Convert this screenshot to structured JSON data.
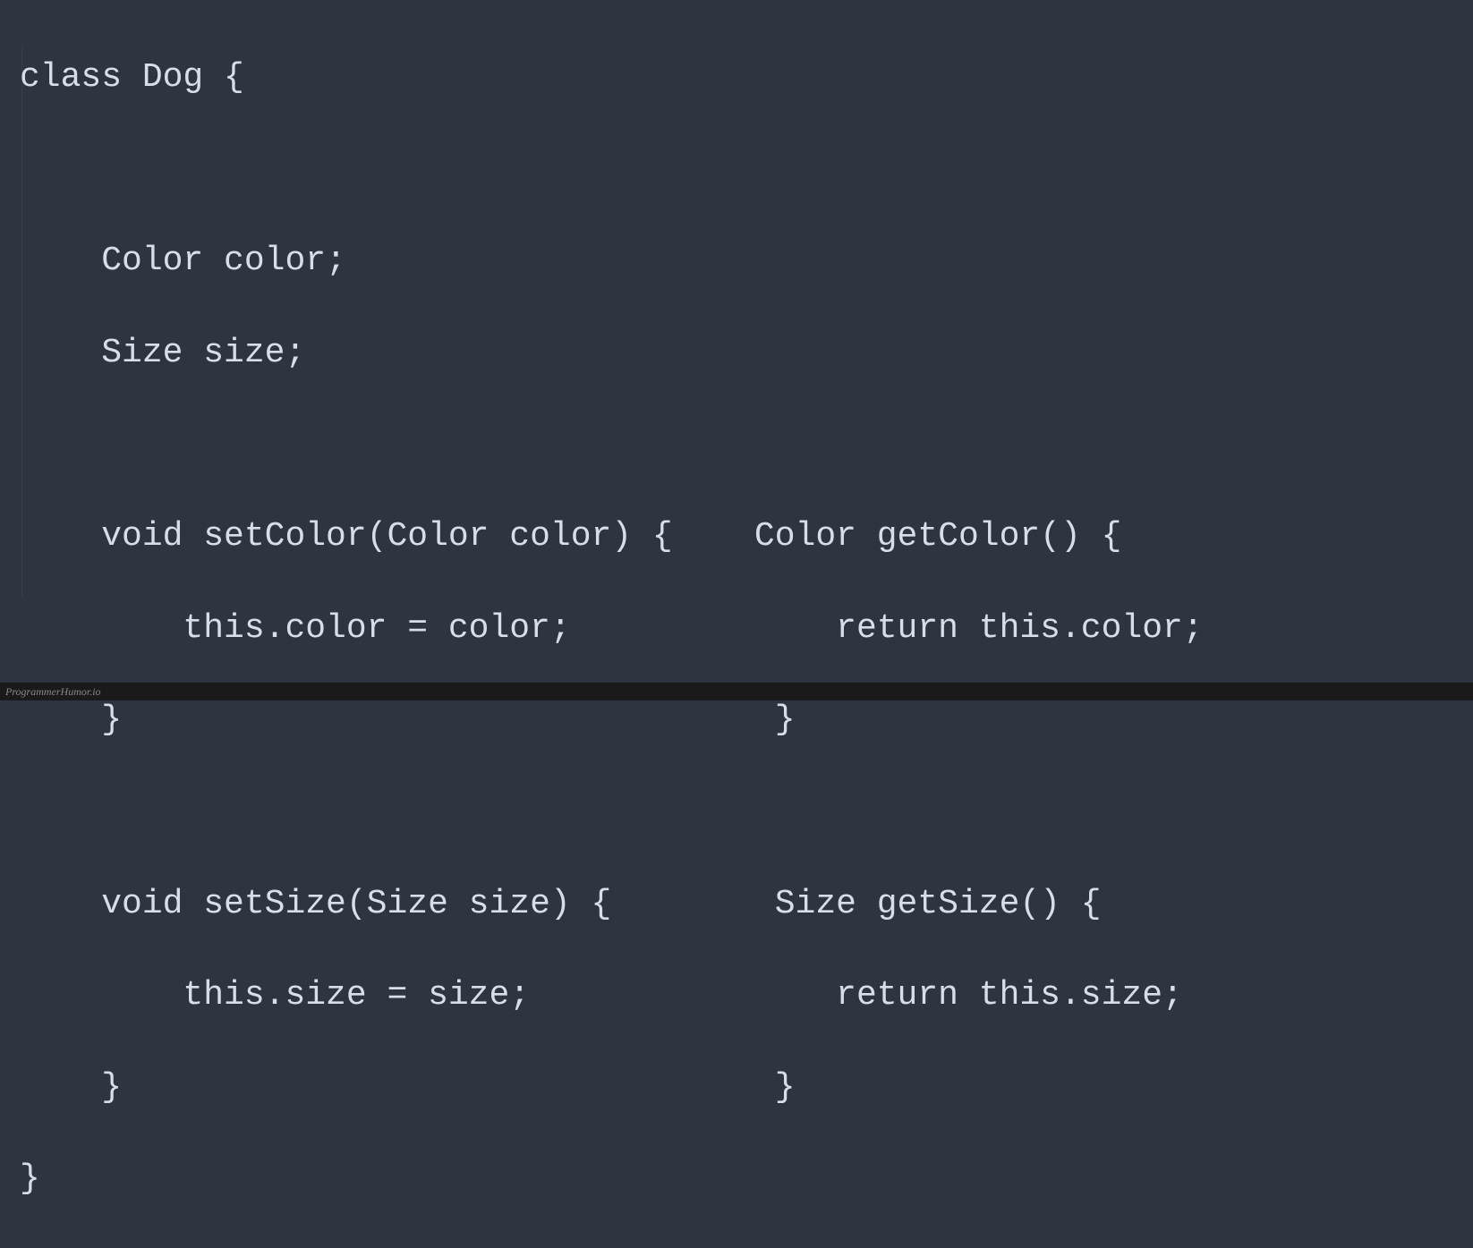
{
  "code": {
    "line1": "class Dog {",
    "line2": "",
    "line3": "    Color color;",
    "line4": "    Size size;",
    "line5": "",
    "line6": "    void setColor(Color color) {    Color getColor() {",
    "line7": "        this.color = color;             return this.color;",
    "line8": "    }                                }",
    "line9": "",
    "line10": "    void setSize(Size size) {        Size getSize() {",
    "line11": "        this.size = size;               return this.size;",
    "line12": "    }                                }",
    "line13": "}"
  },
  "watermark": "ProgrammerHumor.io"
}
